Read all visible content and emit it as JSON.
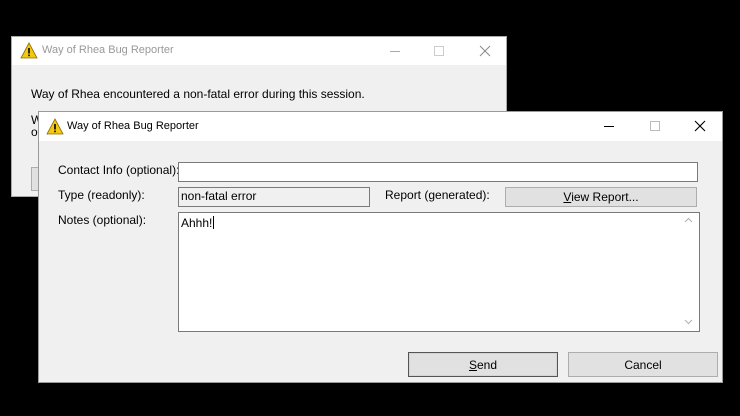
{
  "back_window": {
    "title": "Way of Rhea Bug Reporter",
    "message": "Way of Rhea encountered a non-fatal error during this session.",
    "peek_line1": "W",
    "peek_line2": "o"
  },
  "front_window": {
    "title": "Way of Rhea Bug Reporter",
    "contact_label": "Contact Info (optional):",
    "contact_value": "",
    "type_label": "Type (readonly):",
    "type_value": "non-fatal error",
    "report_label": "Report (generated):",
    "view_report_button": "View Report...",
    "notes_label": "Notes (optional):",
    "notes_value": "Ahhh!",
    "send_button": "Send",
    "cancel_button": "Cancel"
  },
  "icons": {
    "app": "warning-icon",
    "minimize": "minimize-icon",
    "maximize": "maximize-icon",
    "close": "close-icon"
  },
  "colors": {
    "desktop": "#000000",
    "window_bg": "#f0f0f0",
    "titlebar_bg": "#ffffff",
    "warning_yellow": "#f2c811"
  }
}
